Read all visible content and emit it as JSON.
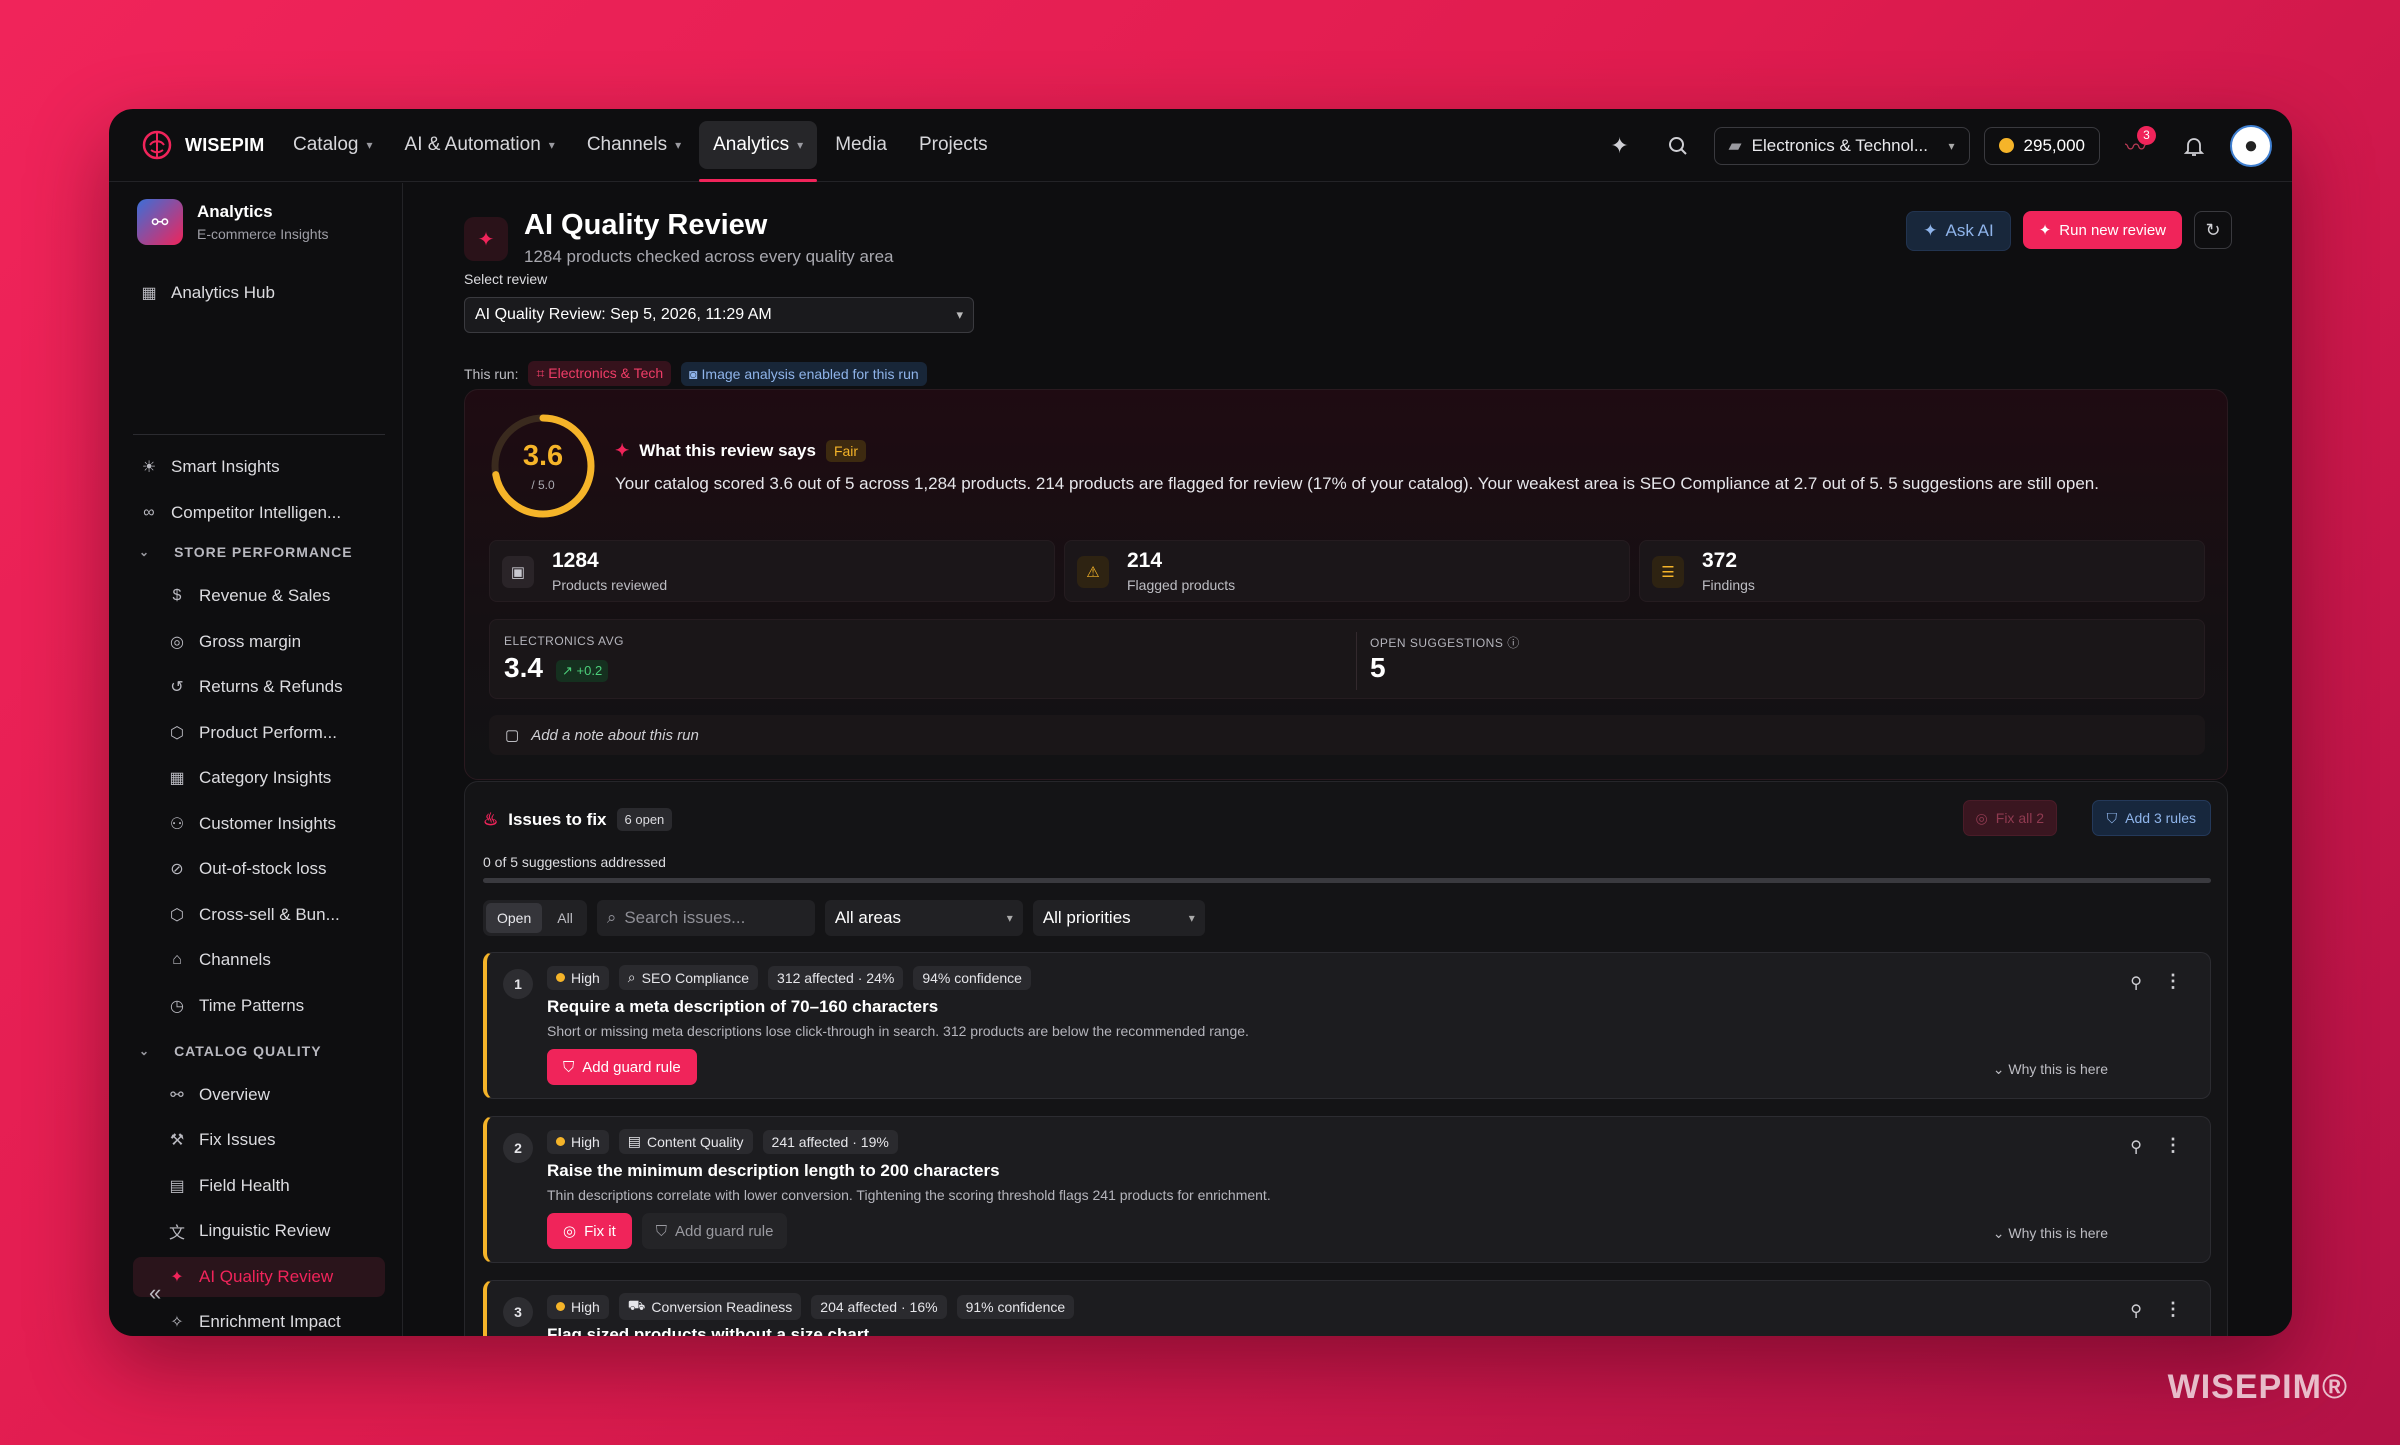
{
  "brand": {
    "name": "WISEPIM",
    "watermark": "WISEPIM®"
  },
  "nav": [
    {
      "label": "Catalog",
      "dropdown": true,
      "active": false
    },
    {
      "label": "AI & Automation",
      "dropdown": true,
      "active": false
    },
    {
      "label": "Channels",
      "dropdown": true,
      "active": false
    },
    {
      "label": "Analytics",
      "dropdown": true,
      "active": true
    },
    {
      "label": "Media",
      "dropdown": false,
      "active": false
    },
    {
      "label": "Projects",
      "dropdown": false,
      "active": false
    }
  ],
  "topbar": {
    "store": "Electronics & Technol...",
    "credits": "295,000",
    "activity_badge": "3"
  },
  "sidebar": {
    "app_title": "Analytics",
    "app_subtitle": "E-commerce Insights",
    "hub": "Analytics Hub",
    "top_items": [
      "Smart Insights",
      "Competitor Intelligen..."
    ],
    "section1": "STORE PERFORMANCE",
    "store_items": [
      "Revenue & Sales",
      "Gross margin",
      "Returns & Refunds",
      "Product Perform...",
      "Category Insights",
      "Customer Insights",
      "Out-of-stock loss",
      "Cross-sell & Bun...",
      "Channels",
      "Time Patterns"
    ],
    "section2": "CATALOG QUALITY",
    "catalog_items": [
      "Overview",
      "Fix Issues",
      "Field Health",
      "Linguistic Review",
      "AI Quality Review",
      "Enrichment Impact"
    ],
    "active_item": "AI Quality Review"
  },
  "page": {
    "title": "AI Quality Review",
    "subtitle": "1284 products checked across every quality area",
    "ask_ai": "Ask AI",
    "run_new": "Run new review",
    "select_label": "Select review",
    "selected_review": "AI Quality Review: Sep 5, 2026, 11:29 AM",
    "this_run_label": "This run:",
    "run_category": "Electronics & Tech",
    "run_image": "Image analysis enabled for this run"
  },
  "summary": {
    "score": "3.6",
    "score_max": "/ 5.0",
    "score_fraction": 0.72,
    "says_title": "What this review says",
    "rating": "Fair",
    "text": "Your catalog scored 3.6 out of 5 across 1,284 products. 214 products are flagged for review (17% of your catalog). Your weakest area is SEO Compliance at 2.7 out of 5. 5 suggestions are still open.",
    "stats": [
      {
        "value": "1284",
        "label": "Products reviewed"
      },
      {
        "value": "214",
        "label": "Flagged products"
      },
      {
        "value": "372",
        "label": "Findings"
      }
    ],
    "avg_label": "ELECTRONICS AVG",
    "avg_value": "3.4",
    "avg_delta": "+0.2",
    "open_label": "OPEN SUGGESTIONS",
    "open_value": "5",
    "note_placeholder": "Add a note about this run"
  },
  "issues": {
    "title": "Issues to fix",
    "open_count": "6 open",
    "fix_all": "Fix all 2",
    "add_rules": "Add 3 rules",
    "addressed": "0 of 5 suggestions addressed",
    "addressed_fraction": 0,
    "filter_open": "Open",
    "filter_all": "All",
    "search_placeholder": "Search issues...",
    "areas": "All areas",
    "priorities": "All priorities",
    "why": "Why this is here",
    "items": [
      {
        "num": "1",
        "priority": "High",
        "area": "SEO Compliance",
        "affected": "312 affected · 24%",
        "confidence": "94% confidence",
        "title": "Require a meta description of 70–160 characters",
        "desc": "Short or missing meta descriptions lose click-through in search. 312 products are below the recommended range.",
        "primary": "Add guard rule",
        "secondary": ""
      },
      {
        "num": "2",
        "priority": "High",
        "area": "Content Quality",
        "affected": "241 affected · 19%",
        "confidence": "",
        "title": "Raise the minimum description length to 200 characters",
        "desc": "Thin descriptions correlate with lower conversion. Tightening the scoring threshold flags 241 products for enrichment.",
        "primary": "Fix it",
        "secondary": "Add guard rule"
      },
      {
        "num": "3",
        "priority": "High",
        "area": "Conversion Readiness",
        "affected": "204 affected · 16%",
        "confidence": "91% confidence",
        "title": "Flag sized products without a size chart",
        "desc": "",
        "primary": "",
        "secondary": ""
      }
    ]
  },
  "colors": {
    "accent": "#f0245a",
    "warning": "#f5b429",
    "info": "#8fb4ea",
    "success": "#4ccf7a"
  }
}
